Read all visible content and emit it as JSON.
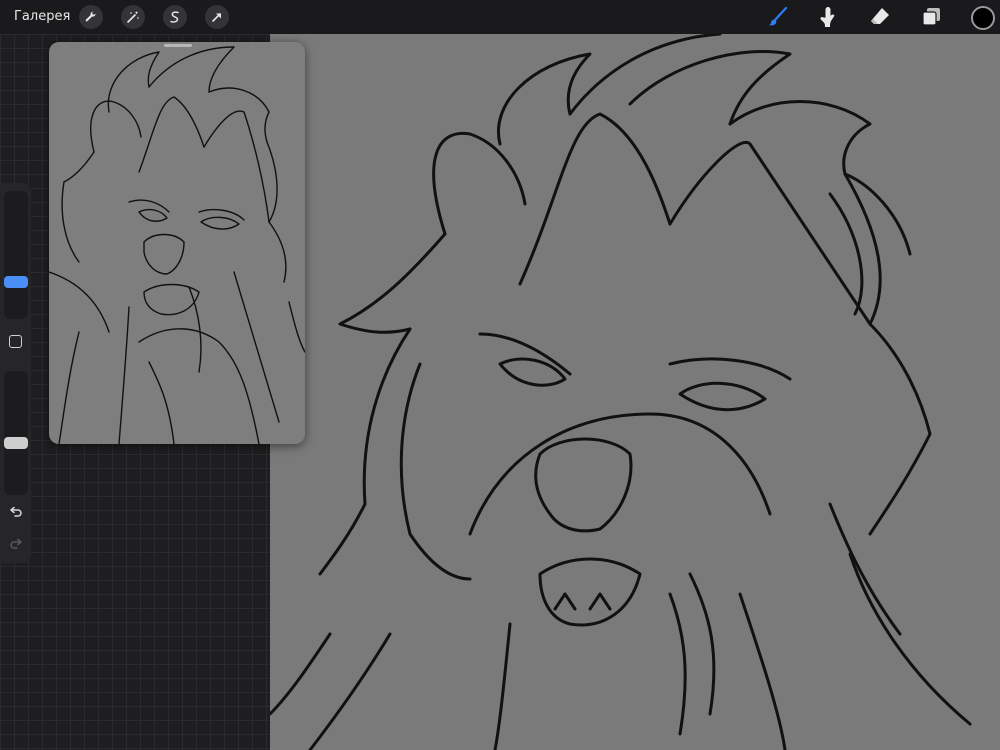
{
  "toolbar": {
    "gallery_label": "Галерея",
    "left_icons": [
      "wrench-icon",
      "magic-wand-icon",
      "selection-icon",
      "transform-arrow-icon"
    ],
    "right_icons": [
      "brush-icon",
      "smudge-icon",
      "eraser-icon",
      "layers-icon"
    ],
    "active_tool": "brush",
    "accent_color": "#2f7df6",
    "current_color": "#000000"
  },
  "sidebar": {
    "brush_size_level": 0.27,
    "opacity_level": 0.41,
    "accent_color": "#4a8ff7"
  },
  "canvas": {
    "background_color": "#7a7a7a"
  },
  "reference": {
    "background_color": "#7e7e7e"
  }
}
